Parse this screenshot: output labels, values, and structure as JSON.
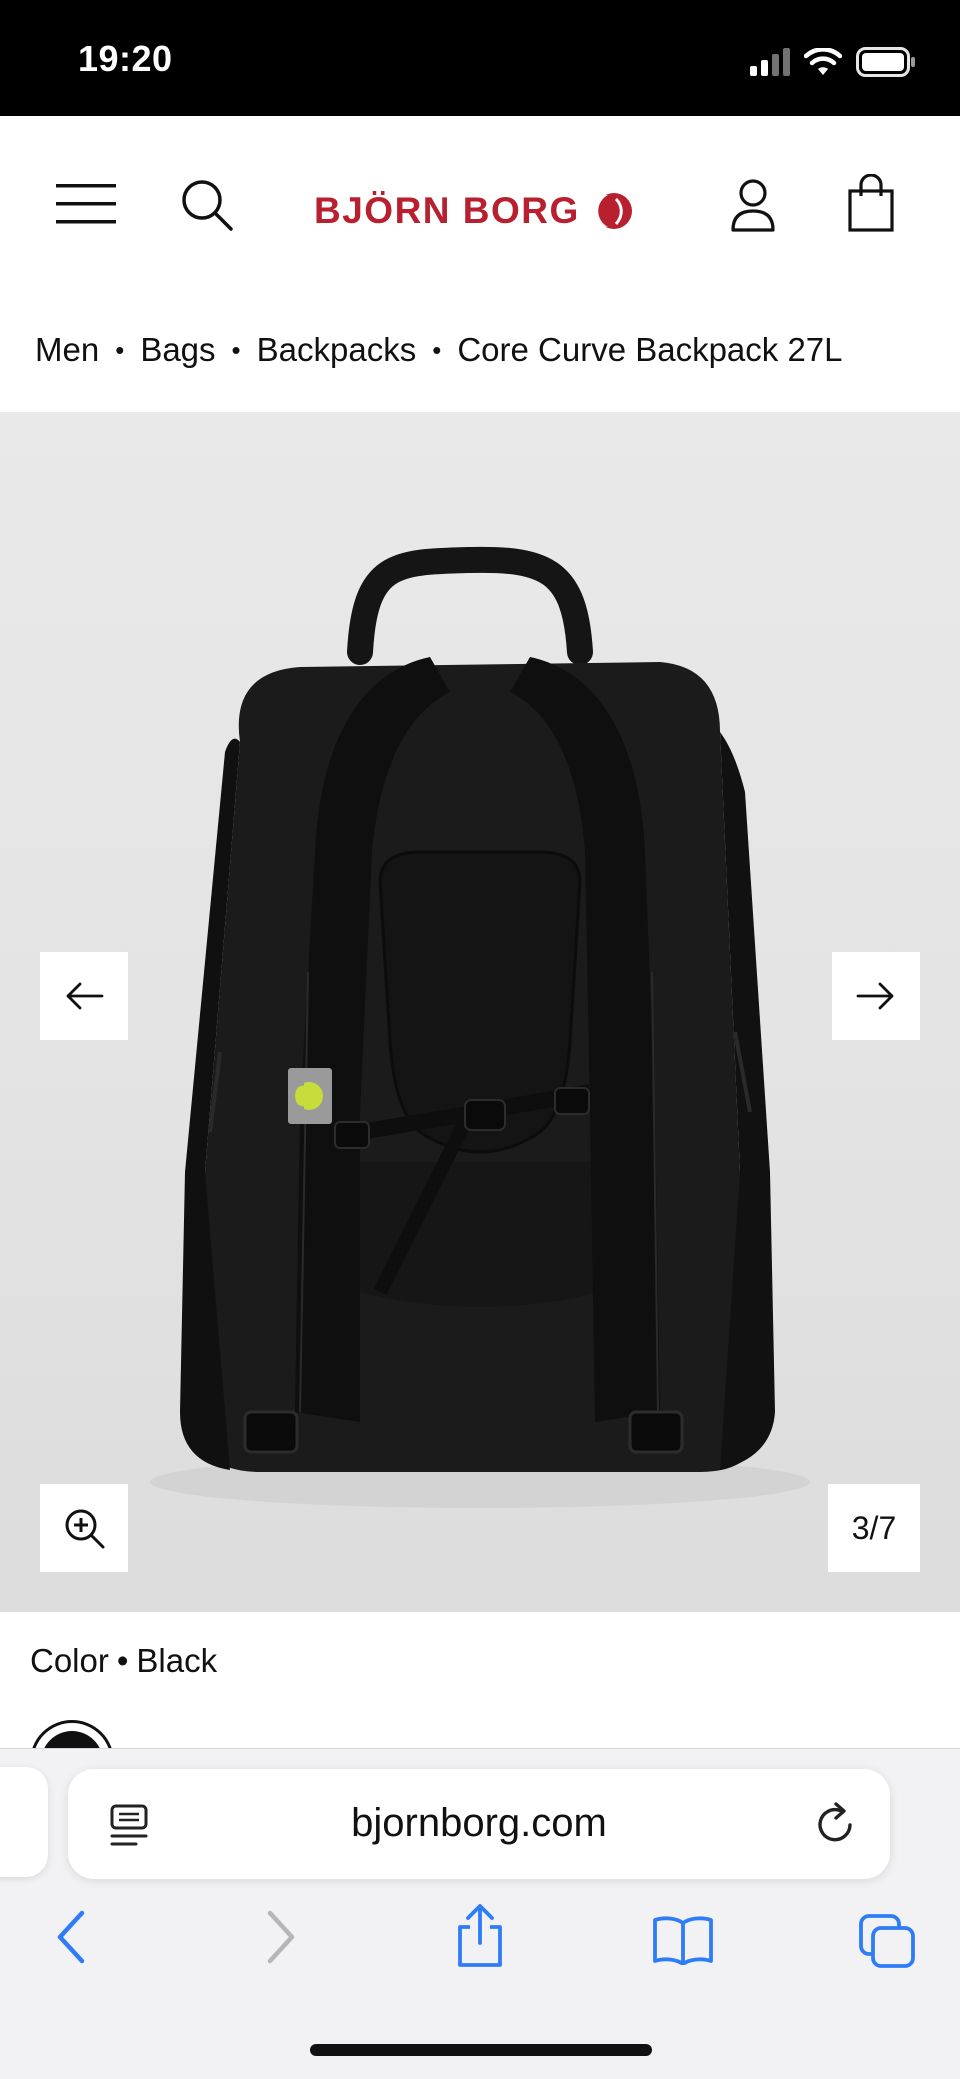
{
  "status_bar": {
    "time": "19:20"
  },
  "header": {
    "brand": "BJÖRN BORG",
    "menu_icon": "hamburger-menu-icon",
    "search_icon": "search-icon",
    "account_icon": "user-icon",
    "cart_icon": "shopping-bag-icon"
  },
  "breadcrumb": {
    "items": [
      "Men",
      "Bags",
      "Backpacks",
      "Core Curve Backpack 27L"
    ],
    "separator": "•"
  },
  "gallery": {
    "counter": "3/7",
    "prev_icon": "arrow-left-icon",
    "next_icon": "arrow-right-icon",
    "zoom_icon": "zoom-in-icon"
  },
  "product": {
    "color_label": "Color",
    "color_separator": "•",
    "color_value": "Black",
    "swatch_color": "#111111"
  },
  "browser": {
    "url": "bjornborg.com",
    "accent": "#2f7df6"
  },
  "colors": {
    "brand": "#b8202f",
    "status_bar": "#000000",
    "gallery_bg": "#e6e6e6"
  }
}
